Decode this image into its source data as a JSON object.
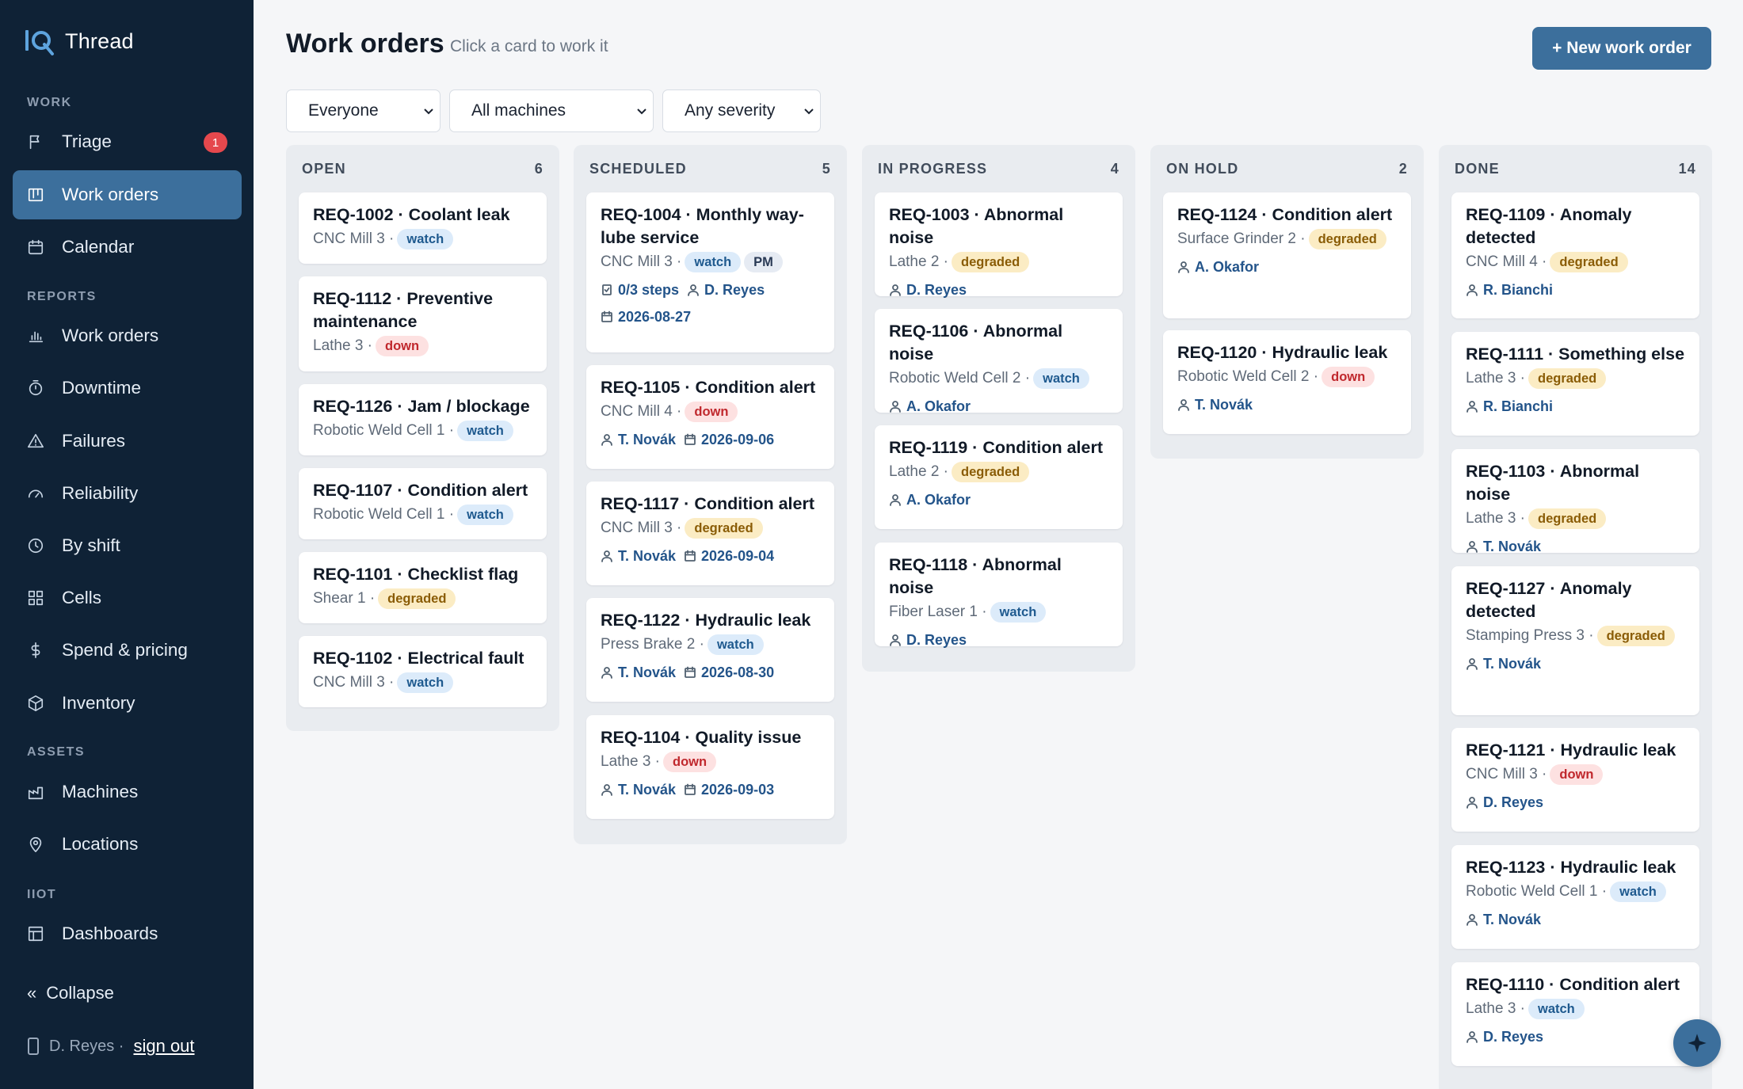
{
  "app": {
    "name": "Thread"
  },
  "sidebar": {
    "sections": {
      "work": "WORK",
      "reports": "REPORTS",
      "assets": "ASSETS",
      "iiot": "IIOT"
    },
    "items": [
      {
        "label": "Triage",
        "icon": "flag-icon",
        "badge": "1"
      },
      {
        "label": "Work orders",
        "icon": "board-icon",
        "active": true
      },
      {
        "label": "Calendar",
        "icon": "calendar-icon"
      },
      {
        "label": "Work orders",
        "icon": "bar-chart-icon"
      },
      {
        "label": "Downtime",
        "icon": "timer-icon"
      },
      {
        "label": "Failures",
        "icon": "warning-icon"
      },
      {
        "label": "Reliability",
        "icon": "gauge-icon"
      },
      {
        "label": "By shift",
        "icon": "clock-icon"
      },
      {
        "label": "Cells",
        "icon": "grid-icon"
      },
      {
        "label": "Spend & pricing",
        "icon": "dollar-icon"
      },
      {
        "label": "Inventory",
        "icon": "box-icon"
      },
      {
        "label": "Machines",
        "icon": "factory-icon"
      },
      {
        "label": "Locations",
        "icon": "pin-icon"
      },
      {
        "label": "Dashboards",
        "icon": "dashboard-icon"
      }
    ],
    "collapse": {
      "glyph": "«",
      "label": "Collapse"
    },
    "user": {
      "name": "D. Reyes ·",
      "signout": "sign out"
    }
  },
  "header": {
    "title": "Work orders",
    "subtitle": "Click a card to work it",
    "new_button": "+ New work order"
  },
  "filters": {
    "assignee": "Everyone",
    "machine": "All machines",
    "severity": "Any severity"
  },
  "columns": [
    {
      "name": "OPEN",
      "count": "6",
      "cards": [
        {
          "title": "REQ-1002 · Coolant leak",
          "machine": "CNC Mill 3 ·",
          "severity": "watch"
        },
        {
          "title": "REQ-1112 · Preventive maintenance",
          "machine": "Lathe 3 ·",
          "severity": "down"
        },
        {
          "title": "REQ-1126 · Jam / blockage",
          "machine": "Robotic Weld Cell 1 ·",
          "severity": "watch"
        },
        {
          "title": "REQ-1107 · Condition alert",
          "machine": "Robotic Weld Cell 1 ·",
          "severity": "watch"
        },
        {
          "title": "REQ-1101 · Checklist flag",
          "machine": "Shear 1 ·",
          "severity": "degraded"
        },
        {
          "title": "REQ-1102 · Electrical fault",
          "machine": "CNC Mill 3 ·",
          "severity": "watch"
        }
      ]
    },
    {
      "name": "SCHEDULED",
      "count": "5",
      "cards": [
        {
          "title": "REQ-1004 · Monthly way-lube service",
          "machine": "CNC Mill 3 ·",
          "severity": "watch",
          "tag": "PM",
          "steps": "0/3 steps",
          "assignee": "D. Reyes",
          "date": "2026-08-27"
        },
        {
          "title": "REQ-1105 · Condition alert",
          "machine": "CNC Mill 4 ·",
          "severity": "down",
          "assignee": "T. Novák",
          "date": "2026-09-06"
        },
        {
          "title": "REQ-1117 · Condition alert",
          "machine": "CNC Mill 3 ·",
          "severity": "degraded",
          "assignee": "T. Novák",
          "date": "2026-09-04"
        },
        {
          "title": "REQ-1122 · Hydraulic leak",
          "machine": "Press Brake 2 ·",
          "severity": "watch",
          "assignee": "T. Novák",
          "date": "2026-08-30"
        },
        {
          "title": "REQ-1104 · Quality issue",
          "machine": "Lathe 3 ·",
          "severity": "down",
          "assignee": "T. Novák",
          "date": "2026-09-03"
        }
      ]
    },
    {
      "name": "IN PROGRESS",
      "count": "4",
      "cards": [
        {
          "title": "REQ-1003 · Abnormal noise",
          "machine": "Lathe 2 ·",
          "severity": "degraded",
          "assignee": "D. Reyes"
        },
        {
          "title": "REQ-1106 · Abnormal noise",
          "machine": "Robotic Weld Cell 2 ·",
          "severity": "watch",
          "assignee": "A. Okafor"
        },
        {
          "title": "REQ-1119 · Condition alert",
          "machine": "Lathe 2 ·",
          "severity": "degraded",
          "assignee": "A. Okafor"
        },
        {
          "title": "REQ-1118 · Abnormal noise",
          "machine": "Fiber Laser 1 ·",
          "severity": "watch",
          "assignee": "D. Reyes"
        }
      ]
    },
    {
      "name": "ON HOLD",
      "count": "2",
      "cards": [
        {
          "title": "REQ-1124 · Condition alert",
          "machine": "Surface Grinder 2 ·",
          "severity": "degraded",
          "assignee": "A. Okafor"
        },
        {
          "title": "REQ-1120 · Hydraulic leak",
          "machine": "Robotic Weld Cell 2 ·",
          "severity": "down",
          "assignee": "T. Novák"
        }
      ]
    },
    {
      "name": "DONE",
      "count": "14",
      "cards": [
        {
          "title": "REQ-1109 · Anomaly detected",
          "machine": "CNC Mill 4 ·",
          "severity": "degraded",
          "assignee": "R. Bianchi"
        },
        {
          "title": "REQ-1111 · Something else",
          "machine": "Lathe 3 ·",
          "severity": "degraded",
          "assignee": "R. Bianchi"
        },
        {
          "title": "REQ-1103 · Abnormal noise",
          "machine": "Lathe 3 ·",
          "severity": "degraded",
          "assignee": "T. Novák"
        },
        {
          "title": "REQ-1127 · Anomaly detected",
          "machine": "Stamping Press 3 ·",
          "severity": "degraded",
          "assignee": "T. Novák"
        },
        {
          "title": "REQ-1121 · Hydraulic leak",
          "machine": "CNC Mill 3 ·",
          "severity": "down",
          "assignee": "D. Reyes"
        },
        {
          "title": "REQ-1123 · Hydraulic leak",
          "machine": "Robotic Weld Cell 1 ·",
          "severity": "watch",
          "assignee": "T. Novák"
        },
        {
          "title": "REQ-1110 · Condition alert",
          "machine": "Lathe 3 ·",
          "severity": "watch",
          "assignee": "D. Reyes"
        }
      ]
    }
  ],
  "fab": {
    "icon": "sparkle-icon"
  },
  "colors": {
    "sidebar_bg": "#0f2236",
    "accent": "#3c6f9c",
    "page_bg": "#f5f6f8"
  }
}
